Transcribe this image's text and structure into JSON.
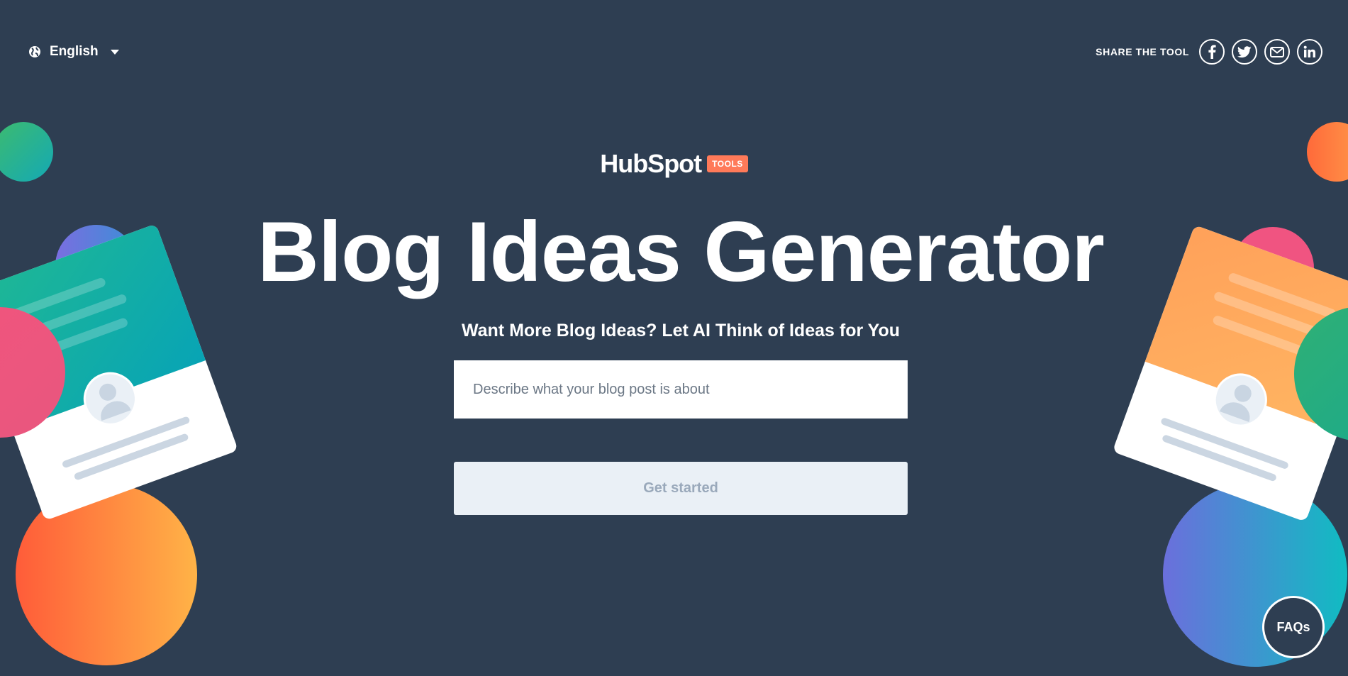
{
  "language": {
    "label": "English"
  },
  "share": {
    "label": "SHARE THE TOOL",
    "icons": [
      "facebook-icon",
      "twitter-icon",
      "email-icon",
      "linkedin-icon"
    ]
  },
  "logo": {
    "word": "HubSpot",
    "badge": "TOOLS"
  },
  "hero": {
    "title": "Blog Ideas Generator",
    "subtitle": "Want More Blog Ideas? Let AI Think of Ideas for You"
  },
  "form": {
    "placeholder": "Describe what your blog post is about",
    "button_label": "Get started"
  },
  "faq": {
    "label": "FAQs"
  },
  "colors": {
    "background": "#2e3e52",
    "accent": "#ff7a59",
    "button_bg": "#eaf0f6",
    "button_text": "#9aa9bb"
  }
}
